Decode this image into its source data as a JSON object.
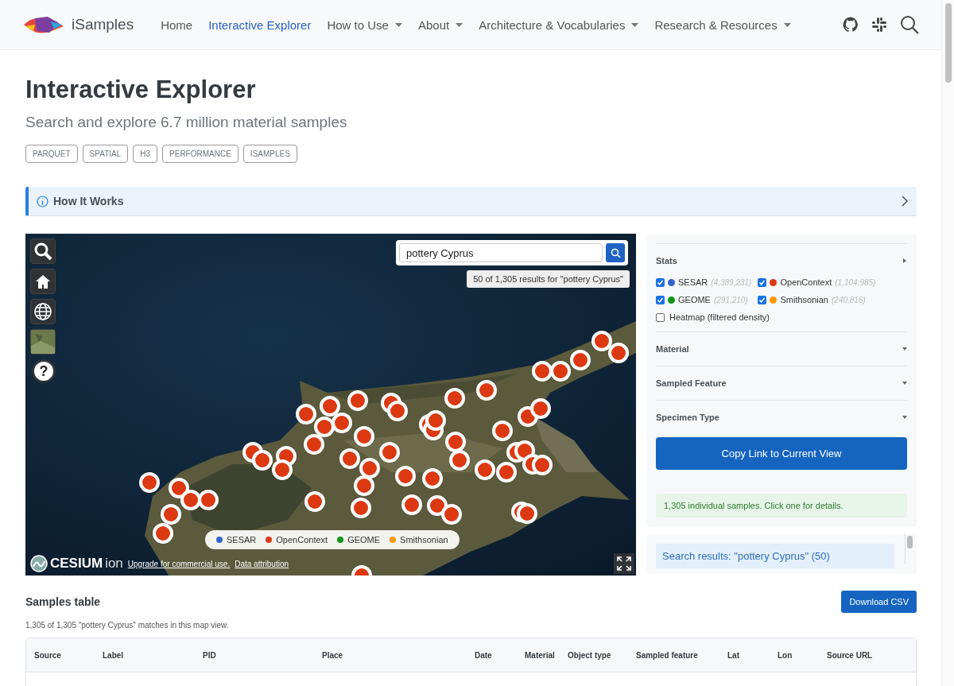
{
  "navbar": {
    "brand": "iSamples",
    "items": [
      {
        "label": "Home",
        "selected": false,
        "dropdown": false
      },
      {
        "label": "Interactive Explorer",
        "selected": true,
        "dropdown": false
      },
      {
        "label": "How to Use",
        "selected": false,
        "dropdown": true
      },
      {
        "label": "About",
        "selected": false,
        "dropdown": true
      },
      {
        "label": "Architecture & Vocabularies",
        "selected": false,
        "dropdown": true
      },
      {
        "label": "Research & Resources",
        "selected": false,
        "dropdown": true
      }
    ]
  },
  "page": {
    "title": "Interactive Explorer",
    "subtitle": "Search and explore 6.7 million material samples",
    "tags": [
      "PARQUET",
      "SPATIAL",
      "H3",
      "PERFORMANCE",
      "ISAMPLES"
    ]
  },
  "callout": {
    "title": "How It Works",
    "expanded": false
  },
  "map": {
    "search": {
      "value": "pottery Cyprus"
    },
    "result_note": "50 of 1,305 results for \"pottery Cyprus\"",
    "help_button": "?",
    "legend": [
      {
        "label": "SESAR",
        "color": "#3366cc"
      },
      {
        "label": "OpenContext",
        "color": "#dc3912"
      },
      {
        "label": "GEOME",
        "color": "#109618"
      },
      {
        "label": "Smithsonian",
        "color": "#ff9900"
      }
    ],
    "credit": {
      "logo": "CESIUM",
      "logo_suffix": "ion",
      "links": [
        "Upgrade for commercial use.",
        "Data attribution"
      ]
    }
  },
  "sidebar": {
    "sections": [
      {
        "title": "Stats",
        "expanded": true,
        "sources": [
          {
            "name": "SESAR",
            "count": "(4,389,231)",
            "color": "#3366cc",
            "checked": true
          },
          {
            "name": "OpenContext",
            "count": "(1,104,985)",
            "color": "#dc3912",
            "checked": true
          },
          {
            "name": "GEOME",
            "count": "(291,210)",
            "color": "#109618",
            "checked": true
          },
          {
            "name": "Smithsonian",
            "count": "(240,816)",
            "color": "#ff9900",
            "checked": true
          }
        ],
        "options": [
          {
            "label": "Heatmap (filtered density)",
            "checked": false
          }
        ]
      },
      {
        "title": "Material",
        "expanded": false
      },
      {
        "title": "Sampled Feature",
        "expanded": false
      },
      {
        "title": "Specimen Type",
        "expanded": false
      }
    ],
    "copy_button": "Copy Link to Current View",
    "status": "1,305 individual samples. Click one for details.",
    "results_header": "Search results: \"pottery Cyprus\" (50)"
  },
  "table": {
    "title": "Samples table",
    "download_button": "Download CSV",
    "summary": "1,305 of 1,305 \"pottery Cyprus\" matches in this map view.",
    "columns": [
      "Source",
      "Label",
      "PID",
      "Place",
      "Date",
      "Material",
      "Object type",
      "Sampled feature",
      "Lat",
      "Lon",
      "Source URL"
    ]
  }
}
